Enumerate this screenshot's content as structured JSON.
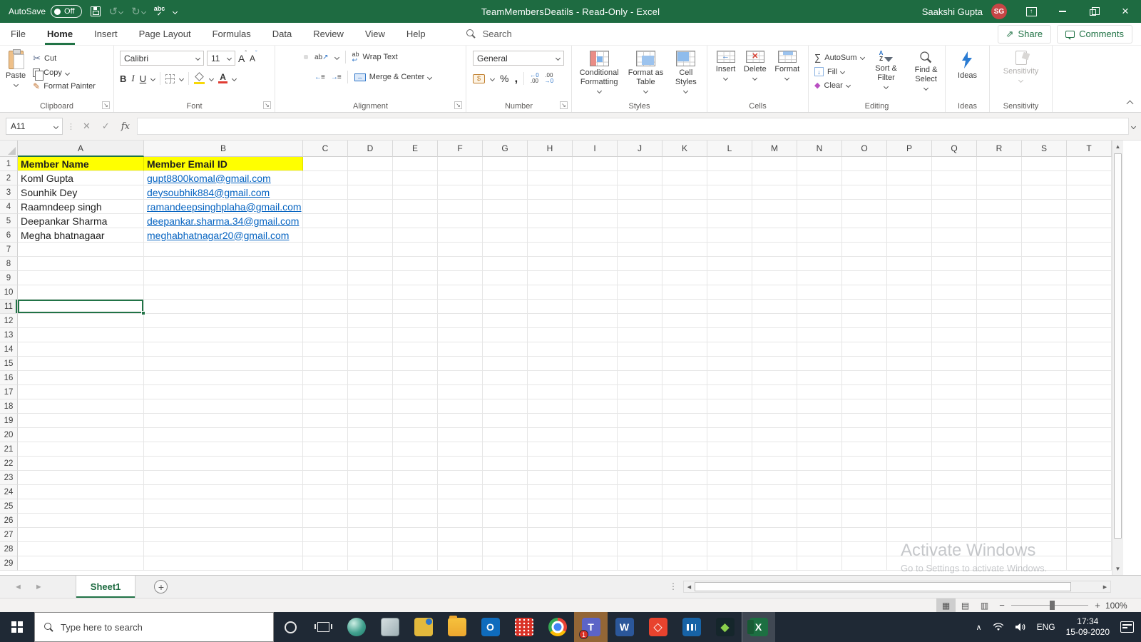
{
  "titlebar": {
    "autosave_label": "AutoSave",
    "autosave_state": "Off",
    "title": "TeamMembersDeatils - Read-Only - Excel",
    "user_name": "Saakshi Gupta",
    "user_initials": "SG",
    "avatar_color": "#c64545"
  },
  "ribbon_tabs": {
    "tabs": [
      {
        "label": "File",
        "active": false
      },
      {
        "label": "Home",
        "active": true
      },
      {
        "label": "Insert",
        "active": false
      },
      {
        "label": "Page Layout",
        "active": false
      },
      {
        "label": "Formulas",
        "active": false
      },
      {
        "label": "Data",
        "active": false
      },
      {
        "label": "Review",
        "active": false
      },
      {
        "label": "View",
        "active": false
      },
      {
        "label": "Help",
        "active": false
      }
    ],
    "search_label": "Search",
    "share_label": "Share",
    "comments_label": "Comments"
  },
  "ribbon": {
    "clipboard": {
      "label": "Clipboard",
      "paste": "Paste",
      "cut": "Cut",
      "copy": "Copy",
      "format_painter": "Format Painter",
      "scissors_glyph": "✂",
      "brush_glyph": "✎"
    },
    "font": {
      "label": "Font",
      "font_name": "Calibri",
      "font_size": "11",
      "bold": "B",
      "italic": "I",
      "underline": "U",
      "grow_glyph": "A",
      "shrink_glyph": "A",
      "color_letter": "A"
    },
    "alignment": {
      "label": "Alignment",
      "wrap_text": "Wrap Text",
      "merge_center": "Merge & Center",
      "ab_glyph": "ab",
      "rot_arrow": "↗",
      "wrap_arrow": "↩",
      "merge_arrows": "↔",
      "indent_out": "←",
      "indent_in": "→"
    },
    "number": {
      "label": "Number",
      "format": "General",
      "currency_glyph": "$",
      "percent_glyph": "%",
      "comma_glyph": ",",
      "inc_dec_top": "←0",
      "inc_dec_bot": ".00",
      "dec_dec_top": ".00",
      "dec_dec_bot": "→0"
    },
    "styles": {
      "label": "Styles",
      "conditional_formatting": "Conditional Formatting",
      "format_as_table": "Format as Table",
      "cell_styles": "Cell Styles"
    },
    "cells": {
      "label": "Cells",
      "insert": "Insert",
      "delete": "Delete",
      "format": "Format",
      "insert_glyph": "←",
      "delete_glyph": "✕"
    },
    "editing": {
      "label": "Editing",
      "autosum": "AutoSum",
      "fill": "Fill",
      "clear": "Clear",
      "sort_filter": "Sort & Filter",
      "find_select": "Find & Select",
      "sigma_glyph": "∑",
      "fill_glyph": "↓",
      "clear_glyph": "◆",
      "az_a": "A",
      "az_z": "Z"
    },
    "ideas": {
      "label": "Ideas",
      "button": "Ideas"
    },
    "sensitivity": {
      "label": "Sensitivity",
      "button": "Sensitivity"
    }
  },
  "formula_bar": {
    "name_box": "A11",
    "cancel_glyph": "✕",
    "enter_glyph": "✓",
    "fx_glyph": "fx"
  },
  "sheet": {
    "columns": [
      "A",
      "B",
      "C",
      "D",
      "E",
      "F",
      "G",
      "H",
      "I",
      "J",
      "K",
      "L",
      "M",
      "N",
      "O",
      "P",
      "Q",
      "R",
      "S",
      "T"
    ],
    "row_count": 29,
    "selected_cell": {
      "row": 11,
      "col": "A",
      "ref": "A11"
    },
    "header_row": {
      "col_a": "Member Name",
      "col_b": "Member Email ID",
      "fill": "#ffff00"
    },
    "members": [
      {
        "name": "Koml Gupta",
        "email": "gupt8800komal@gmail.com"
      },
      {
        "name": "Sounhik Dey",
        "email": "deysoubhik884@gmail.com"
      },
      {
        "name": "Raamndeep singh",
        "email": "ramandeepsinghplaha@gmail.com"
      },
      {
        "name": "Deepankar Sharma",
        "email": "deepankar.sharma.34@gmail.com"
      },
      {
        "name": "Megha bhatnagaar",
        "email": "meghabhatnagar20@gmail.com"
      }
    ],
    "link_color": "#0563c1"
  },
  "sheet_tabs": {
    "active_tab": "Sheet1",
    "add_glyph": "+",
    "prev_glyph": "◄",
    "next_glyph": "►"
  },
  "status_bar": {
    "zoom_level": "100%",
    "normal_glyph": "▦",
    "page_layout_glyph": "▤",
    "page_break_glyph": "▥",
    "zoom_out_glyph": "−",
    "zoom_in_glyph": "+"
  },
  "watermark": {
    "line1": "Activate Windows",
    "line2": "Go to Settings to activate Windows."
  },
  "taskbar": {
    "search_placeholder": "Type here to search",
    "icons": [
      {
        "name": "network-globe",
        "glyph": ""
      },
      {
        "name": "notes",
        "glyph": ""
      },
      {
        "name": "yellow-cylinder",
        "glyph": ""
      },
      {
        "name": "file-explorer",
        "glyph": ""
      },
      {
        "name": "outlook",
        "glyph": "O"
      },
      {
        "name": "red-basket",
        "glyph": ""
      },
      {
        "name": "chrome",
        "glyph": ""
      },
      {
        "name": "teams",
        "glyph": "T",
        "active": true,
        "badge": "1"
      },
      {
        "name": "word",
        "glyph": "W"
      },
      {
        "name": "red-diamond",
        "glyph": "◇"
      },
      {
        "name": "presentation",
        "glyph": ""
      },
      {
        "name": "green-diamond",
        "glyph": "◆"
      },
      {
        "name": "excel",
        "glyph": "X",
        "active": true
      }
    ],
    "tray": {
      "language": "ENG",
      "time": "17:34",
      "date": "15-09-2020"
    }
  }
}
